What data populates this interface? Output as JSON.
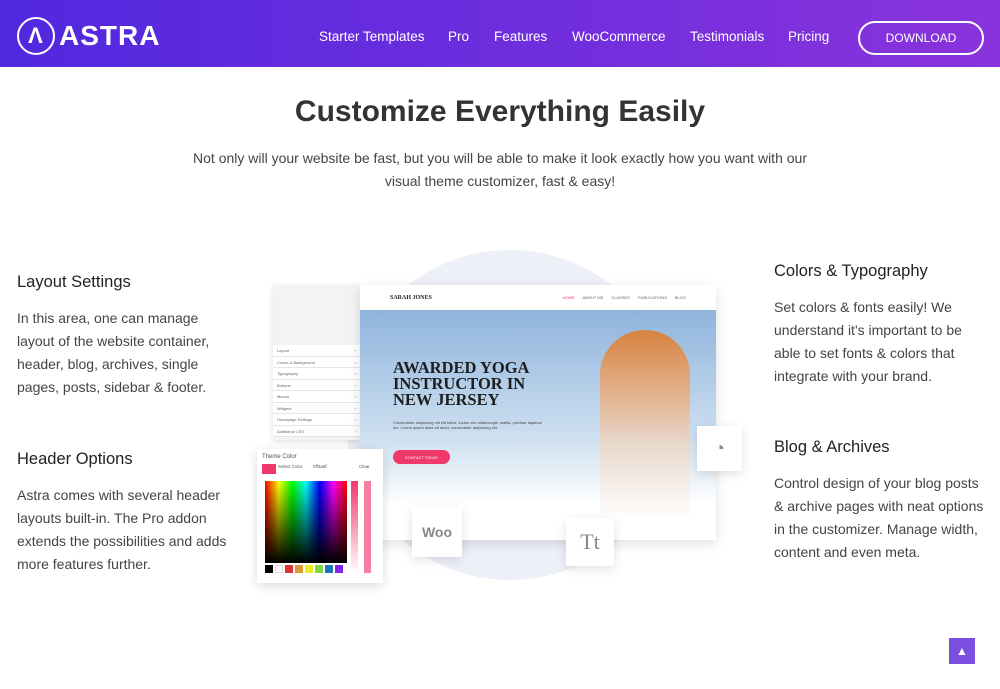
{
  "header": {
    "logo": "ASTRA",
    "nav": [
      "Starter Templates",
      "Pro",
      "Features",
      "WooCommerce",
      "Testimonials",
      "Pricing"
    ],
    "download": "DOWNLOAD"
  },
  "hero": {
    "title": "Customize Everything Easily",
    "subtitle": "Not only will your website be fast, but you will be able to make it look exactly how you want with our visual theme customizer, fast & easy!"
  },
  "features": [
    {
      "title": "Layout Settings",
      "text": "In this area, one can manage layout of the website container, header, blog, archives, single pages, posts, sidebar & footer."
    },
    {
      "title": "Header Options",
      "text": "Astra comes with several header layouts built-in. The Pro addon extends the possibilities and adds more features further."
    },
    {
      "title": "Colors & Typography",
      "text": "Set colors & fonts easily! We understand it's important to be able to set fonts & colors that integrate with your brand."
    },
    {
      "title": "Blog & Archives",
      "text": "Control design of your blog posts & archive pages with neat options in the customizer. Manage width, content and even meta."
    }
  ],
  "illustration": {
    "customizer_items": [
      "Layout",
      "Colors & Background",
      "Typography",
      "Buttons",
      "Menus",
      "Widgets",
      "Homepage Settings",
      "Additional CSS"
    ],
    "site_logo": "SARAH JONES",
    "site_nav": [
      "HOME",
      "ABOUT ME",
      "CLASSES",
      "PUBLICATIONS",
      "BLOG"
    ],
    "site_heading": "AWARDED YOGA INSTRUCTOR IN NEW JERSEY",
    "site_text": "Consectetur adipiscing elit elit tellus, luctus nec ullamcorper mattis, pulvinar dapibus leo. Lorem ipsum dolor sit amet, consectetur adipiscing elit.",
    "site_button": "CONTACT TODAY",
    "picker_title": "Theme Color",
    "picker_select": "Select Color",
    "picker_value": "#ff3a6f",
    "picker_clear": "Clear",
    "woo": "Woo",
    "tt": "Tt"
  },
  "colors": {
    "header_start": "#5128de",
    "header_end": "#8a33dc",
    "accent": "#f0386b"
  }
}
